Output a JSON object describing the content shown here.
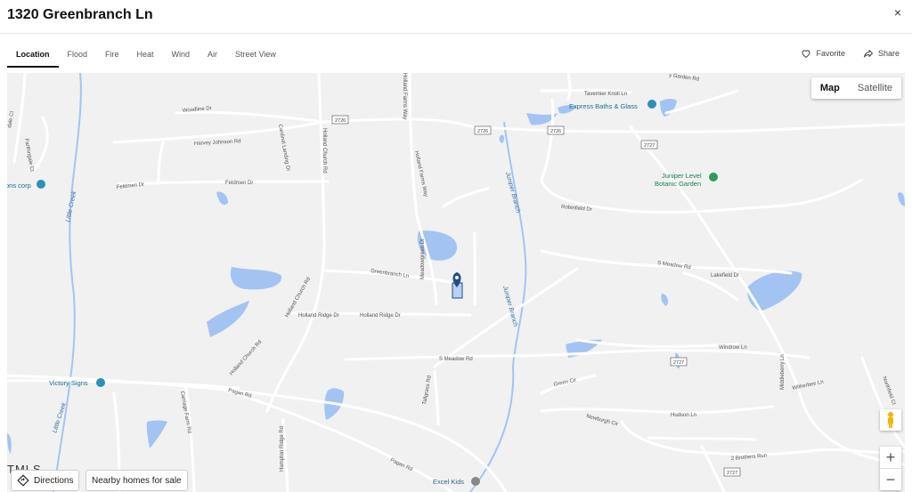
{
  "header": {
    "title": "1320 Greenbranch Ln",
    "close": "×"
  },
  "tabs": [
    "Location",
    "Flood",
    "Fire",
    "Heat",
    "Wind",
    "Air",
    "Street View"
  ],
  "actions": {
    "favorite": "Favorite",
    "share": "Share"
  },
  "map_type": {
    "map": "Map",
    "satellite": "Satellite"
  },
  "zoom": {
    "in": "+",
    "out": "−"
  },
  "buttons": {
    "directions": "Directions",
    "nearby": "Nearby homes for sale"
  },
  "attribution": "ТMLS",
  "pois": {
    "express": "Express Baths & Glass",
    "juniper_1": "Juniper Level",
    "juniper_2": "Botanic Garden",
    "victory": "Victory Signs",
    "excel": "Excel Kids",
    "signs_corp": "ons corp"
  },
  "roads": {
    "woodline": "Woodline Dr",
    "harvey": "Harvey Johnson Rd",
    "feldmen1": "Feldmen Dr",
    "feldmen2": "Feldmen Dr",
    "cardinal": "Cardinal Landing Dr",
    "holland_church_top": "Holland Church Rd",
    "holland_farms_top": "Holland Farms Way",
    "holland_farms": "Holland Farms Way",
    "tavernier": "Tavernier Knoll Ln",
    "garden": "y Garden Rd",
    "robinfield": "Robinfield Dr",
    "meadowgreen": "Meadowgreen Dr",
    "greenbranch": "Greenbranch Ln",
    "holland_church_mid": "Holland Church Rd",
    "holland_ridge1": "Holland Ridge Dr",
    "holland_ridge2": "Holland Ridge Dr",
    "holland_church_low": "Holland Church Rd",
    "s_meadow_top": "S Meadow Rd",
    "lakefield": "Lakefield Dr",
    "windrow": "Windrow Ln",
    "s_meadow_low": "S Meadow Rd",
    "witherbee": "Witherbee Ln",
    "green_cir": "Green Cir",
    "newburgh": "Newburgh Cir",
    "hudson": "Hudson Ln",
    "middleberry": "Middleberry Ln",
    "northfield": "Northfield Ct",
    "tallgrass": "Tallgrass Rd",
    "pagan1": "Pagan Rd",
    "pagan2": "Pagan Rd",
    "carriage": "Carriage Farm Rd",
    "hampton": "Hampton Ridge Rd",
    "brothers": "2 Brothers Run",
    "farthingale": "Farthingale Ct",
    "dale": "dale Ct",
    "rd2726a": "2726",
    "rd2726b": "2726",
    "rd2726c": "2726",
    "rd2727a": "2727",
    "rd2727b": "2727",
    "rd2727c": "2727"
  },
  "water": {
    "little_creek1": "Little Creek",
    "little_creek2": "Little Creek",
    "juniper_branch1": "Juniper Branch",
    "juniper_branch2": "Juniper Branch"
  },
  "colors": {
    "water": "#a3c4f3",
    "road": "#ffffff",
    "land": "#f0f1f0",
    "pin": "#1f4f88"
  }
}
